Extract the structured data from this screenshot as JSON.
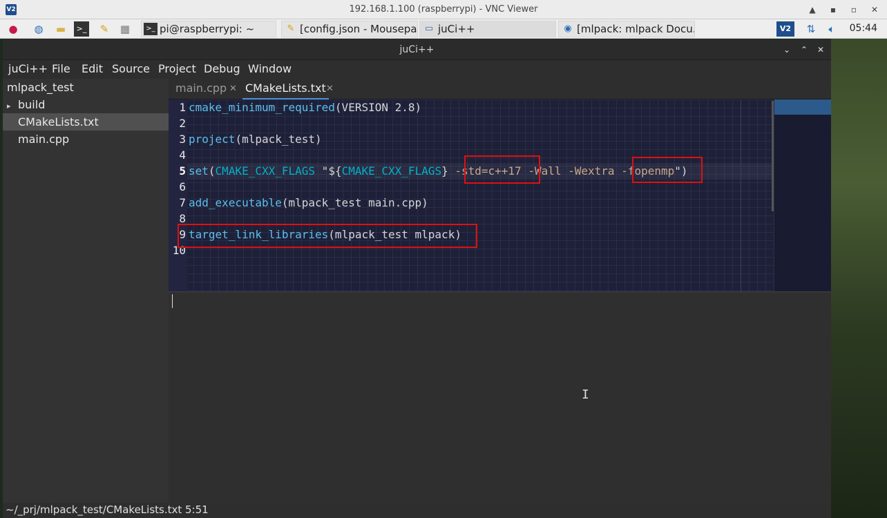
{
  "vnc": {
    "title": "192.168.1.100 (raspberrypi) - VNC Viewer",
    "logo": "V2",
    "ctl_pin": "▲",
    "ctl_min": "▪",
    "ctl_max": "▫",
    "ctl_close": "✕"
  },
  "taskbar": {
    "icons": [
      "raspberry-menu-icon",
      "web-browser-icon",
      "file-manager-icon",
      "terminal-icon",
      "text-editor-icon",
      "archive-icon"
    ],
    "tasks": [
      {
        "label": "pi@raspberrypi: ~",
        "icon": ">_"
      },
      {
        "label": "[config.json - Mousepa...",
        "icon": "✎"
      },
      {
        "label": "juCi++",
        "icon": "▭"
      },
      {
        "label": "[mlpack: mlpack Docu...",
        "icon": "◉"
      }
    ],
    "tray_vnc": "V2",
    "time": "05:44"
  },
  "app": {
    "title": "juCi++",
    "ctl_min": "⌄",
    "ctl_max": "⌃",
    "ctl_close": "✕",
    "menu": [
      "juCi++",
      "File",
      "Edit",
      "Source",
      "Project",
      "Debug",
      "Window"
    ]
  },
  "sidebar": {
    "root": "mlpack_test",
    "items": [
      {
        "label": "build",
        "expander": "▸"
      },
      {
        "label": "CMakeLists.txt"
      },
      {
        "label": "main.cpp"
      }
    ]
  },
  "tabs": [
    {
      "label": "main.cpp",
      "close": "✕"
    },
    {
      "label": "CMakeLists.txt",
      "close": "✕"
    }
  ],
  "code": {
    "line_numbers": [
      "1",
      "2",
      "3",
      "4",
      "5",
      "6",
      "7",
      "8",
      "9",
      "10"
    ],
    "l1": {
      "fn": "cmake_minimum_required",
      "rest": "(VERSION 2.8)"
    },
    "l3": {
      "fn": "project",
      "rest": "(mlpack_test)"
    },
    "l5": {
      "fn": "set",
      "p1": "(",
      "var1": "CMAKE_CXX_FLAGS",
      "p2": " \"${",
      "var2": "CMAKE_CXX_FLAGS",
      "p3": "} ",
      "f1": "-std=c++17",
      "p4": " ",
      "f2": "-Wall",
      "p5": " ",
      "f3": "-Wextra",
      "p6": " ",
      "f4": "-fopenmp",
      "p7": "\")"
    },
    "l7": {
      "fn": "add_executable",
      "rest": "(mlpack_test main.cpp)"
    },
    "l9": {
      "fn": "target_link_libraries",
      "rest": "(mlpack_test mlpack)"
    }
  },
  "status": {
    "text": "~/_prj/mlpack_test/CMakeLists.txt 5:51"
  },
  "colors": {
    "accent": "#4a90d9",
    "highlight_box": "#e01010",
    "editor_bg": "#1e2038"
  }
}
